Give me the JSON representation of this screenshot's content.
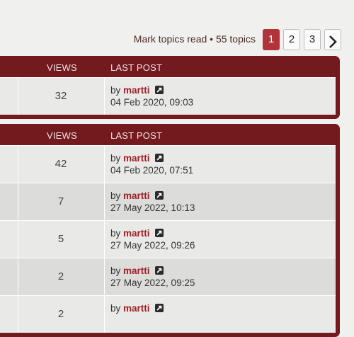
{
  "actionbar": {
    "mark_read": "Mark topics read",
    "separator": " • ",
    "topic_count": "55 topics"
  },
  "pagination": {
    "pages": [
      "1",
      "2",
      "3"
    ],
    "active": "1",
    "next_icon": "chevron-right-icon"
  },
  "panel1": {
    "header": {
      "views": "VIEWS",
      "last_post": "LAST POST"
    },
    "rows": [
      {
        "views": "32",
        "by": "by",
        "author": "martti",
        "date": "04 Feb 2020, 09:03"
      }
    ]
  },
  "panel2": {
    "header": {
      "views": "VIEWS",
      "last_post": "LAST POST"
    },
    "rows": [
      {
        "views": "42",
        "by": "by",
        "author": "martti",
        "date": "04 Feb 2020, 07:51"
      },
      {
        "views": "7",
        "by": "by",
        "author": "martti",
        "date": "27 May 2022, 10:13"
      },
      {
        "views": "5",
        "by": "by",
        "author": "martti",
        "date": "27 May 2022, 09:26"
      },
      {
        "views": "2",
        "by": "by",
        "author": "martti",
        "date": "27 May 2022, 09:25"
      },
      {
        "views": "2",
        "by": "by",
        "author": "martti",
        "date": ""
      }
    ]
  },
  "colors": {
    "header_bg": "#731a1e",
    "active_page": "#b1343a",
    "author": "#a01e27"
  }
}
